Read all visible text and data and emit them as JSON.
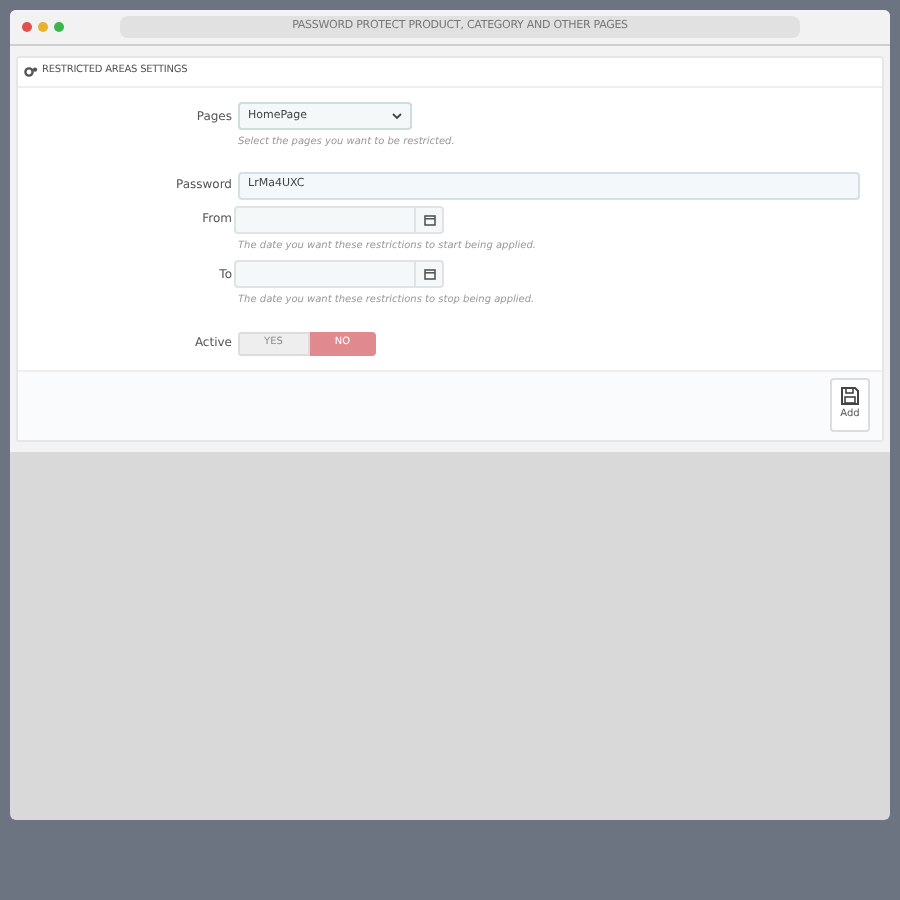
{
  "window": {
    "title": "PASSWORD PROTECT PRODUCT, CATEGORY AND OTHER PAGES"
  },
  "panel": {
    "title": "RESTRICTED AREAS SETTINGS",
    "fields": [
      {
        "kind": "select",
        "label": "Pages",
        "value": "HomePage",
        "help": "Select the pages you want to be restricted."
      },
      {
        "kind": "text",
        "label": "Password",
        "value": "LrMa4UXC"
      },
      {
        "kind": "date",
        "label": "From",
        "help": "The date you want these restrictions to start being applied."
      },
      {
        "kind": "date",
        "label": "To",
        "help": "The date you want these restrictions to stop being applied."
      },
      {
        "kind": "switch",
        "label": "Active",
        "options": [
          {
            "label": "YES",
            "selected": false
          },
          {
            "label": "NO",
            "selected": true
          }
        ]
      }
    ],
    "footer": {
      "button": "Add"
    }
  }
}
